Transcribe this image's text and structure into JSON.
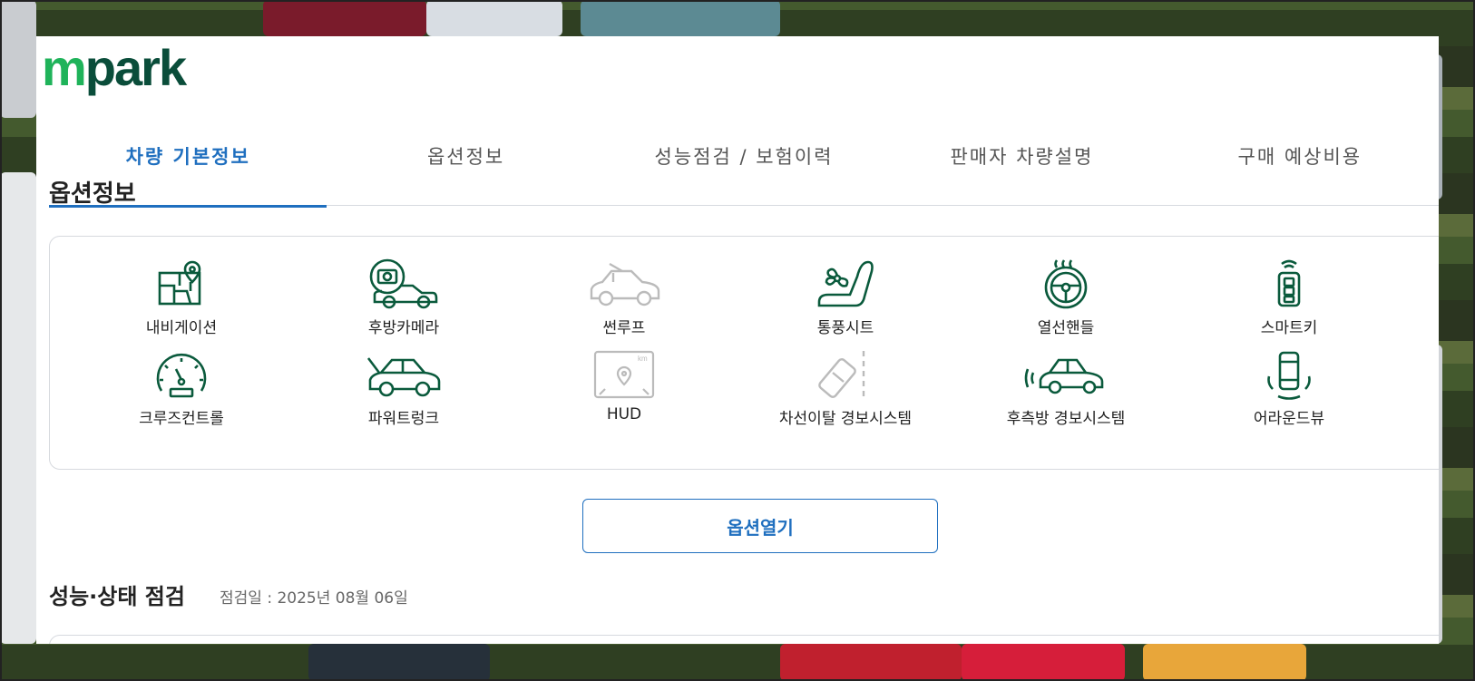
{
  "logo": {
    "m": "m",
    "rest": "park"
  },
  "tabs": [
    {
      "label": "차량 기본정보",
      "active": true
    },
    {
      "label": "옵션정보",
      "active": false
    },
    {
      "label": "성능점검 / 보험이력",
      "active": false
    },
    {
      "label": "판매자 차량설명",
      "active": false
    },
    {
      "label": "구매 예상비용",
      "active": false
    }
  ],
  "options_section": {
    "title": "옵션정보",
    "items": [
      {
        "label": "내비게이션",
        "icon": "navigation-icon",
        "available": true
      },
      {
        "label": "후방카메라",
        "icon": "rear-camera-icon",
        "available": true
      },
      {
        "label": "썬루프",
        "icon": "sunroof-icon",
        "available": false
      },
      {
        "label": "통풍시트",
        "icon": "ventilated-seat-icon",
        "available": true
      },
      {
        "label": "열선핸들",
        "icon": "heated-steering-icon",
        "available": true
      },
      {
        "label": "스마트키",
        "icon": "smart-key-icon",
        "available": true
      },
      {
        "label": "크루즈컨트롤",
        "icon": "cruise-control-icon",
        "available": true
      },
      {
        "label": "파워트렁크",
        "icon": "power-trunk-icon",
        "available": true
      },
      {
        "label": "HUD",
        "icon": "hud-icon",
        "available": false
      },
      {
        "label": "차선이탈 경보시스템",
        "icon": "lane-departure-icon",
        "available": false
      },
      {
        "label": "후측방 경보시스템",
        "icon": "blind-spot-icon",
        "available": true
      },
      {
        "label": "어라운드뷰",
        "icon": "around-view-icon",
        "available": true
      }
    ],
    "open_button": "옵션열기"
  },
  "performance": {
    "title": "성능·상태 점검",
    "date_text": "점검일 : 2025년 08월 06일"
  },
  "colors": {
    "accent": "#1f6fbf",
    "icon_on": "#0a5a3c",
    "icon_off": "#bbbbbb",
    "logo_green": "#1fb35a",
    "logo_dark": "#0a4d3a"
  }
}
